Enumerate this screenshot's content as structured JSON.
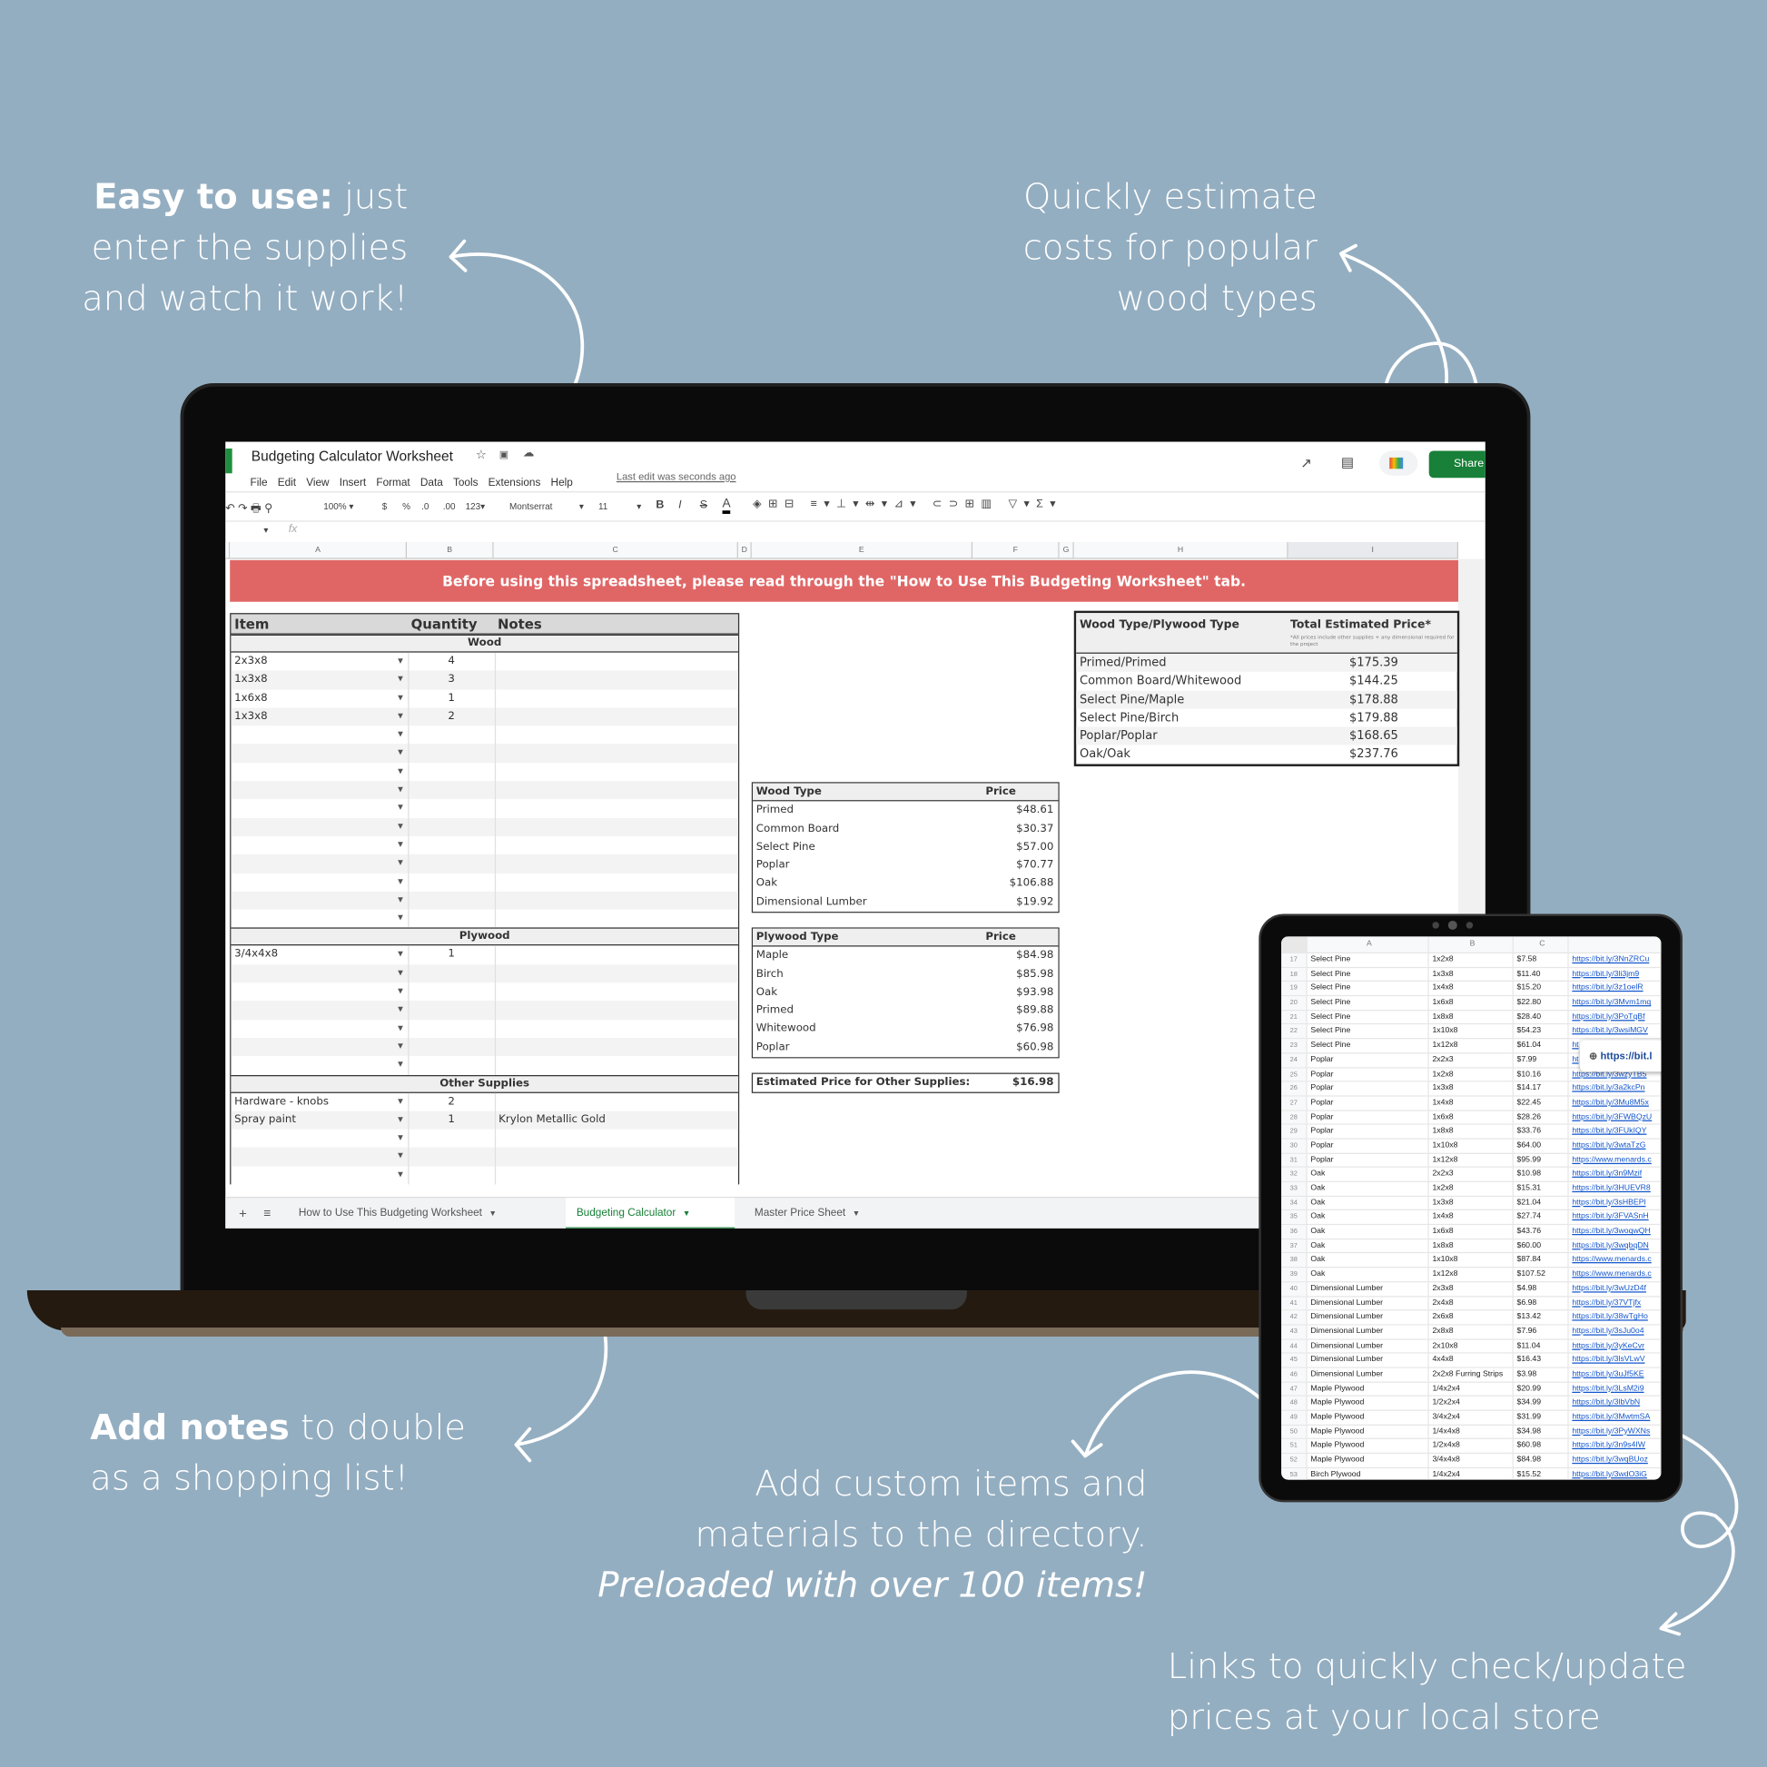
{
  "colors": {
    "background": "#94aec1",
    "banner": "#e06666",
    "share": "#188038",
    "active_tab": "#188038",
    "link": "#1155cc"
  },
  "callouts": {
    "easy": {
      "bold": "Easy to use:",
      "rest": " just",
      "line2": "enter the supplies",
      "line3": "and watch it work!"
    },
    "quick": {
      "line1": "Quickly estimate",
      "line2": "costs for popular",
      "line3": "wood types"
    },
    "notes": {
      "bold": "Add notes",
      "rest": " to double",
      "line2": "as a shopping list!"
    },
    "custom": {
      "line1": "Add custom items and",
      "line2": "materials to the directory.",
      "line3": "Preloaded with over 100 items!"
    },
    "links": {
      "line1": "Links to quickly check/update",
      "line2": "prices at your local store"
    }
  },
  "sheet": {
    "title": "Budgeting Calculator Worksheet",
    "menu": [
      "File",
      "Edit",
      "View",
      "Insert",
      "Format",
      "Data",
      "Tools",
      "Extensions",
      "Help"
    ],
    "last_edit": "Last edit was seconds ago",
    "share_label": "Share",
    "toolbar": {
      "zoom": "100%",
      "currency": "$",
      "percent": "%",
      "dec_less": ".0",
      "dec_more": ".00",
      "format": "123",
      "font": "Montserrat",
      "size": "11",
      "bold": "B",
      "italic": "I",
      "strike": "S",
      "text_color": "A"
    },
    "fx": "fx",
    "columns": [
      "A",
      "B",
      "C",
      "D",
      "E",
      "F",
      "G",
      "H",
      "I"
    ],
    "banner": "Before using this spreadsheet, please read through the \"How to Use This Budgeting Worksheet\" tab.",
    "items_table": {
      "headers": {
        "item": "Item",
        "quantity": "Quantity",
        "notes": "Notes"
      },
      "sections": [
        {
          "title": "Wood",
          "rows": [
            {
              "item": "2x3x8",
              "qty": "4",
              "notes": ""
            },
            {
              "item": "1x3x8",
              "qty": "3",
              "notes": ""
            },
            {
              "item": "1x6x8",
              "qty": "1",
              "notes": ""
            },
            {
              "item": "1x3x8",
              "qty": "2",
              "notes": ""
            },
            {},
            {},
            {},
            {},
            {},
            {},
            {},
            {},
            {},
            {},
            {}
          ]
        },
        {
          "title": "Plywood",
          "rows": [
            {
              "item": "3/4x4x8",
              "qty": "1",
              "notes": ""
            },
            {},
            {},
            {},
            {},
            {},
            {}
          ]
        },
        {
          "title": "Other Supplies",
          "rows": [
            {
              "item": "Hardware - knobs",
              "qty": "2",
              "notes": ""
            },
            {
              "item": "Spray paint",
              "qty": "1",
              "notes": "Krylon Metallic Gold"
            },
            {},
            {},
            {}
          ]
        }
      ]
    },
    "wood_prices": {
      "headers": [
        "Wood Type",
        "Price"
      ],
      "rows": [
        [
          "Primed",
          "$48.61"
        ],
        [
          "Common Board",
          "$30.37"
        ],
        [
          "Select Pine",
          "$57.00"
        ],
        [
          "Poplar",
          "$70.77"
        ],
        [
          "Oak",
          "$106.88"
        ],
        [
          "Dimensional Lumber",
          "$19.92"
        ]
      ]
    },
    "plywood_prices": {
      "headers": [
        "Plywood Type",
        "Price"
      ],
      "rows": [
        [
          "Maple",
          "$84.98"
        ],
        [
          "Birch",
          "$85.98"
        ],
        [
          "Oak",
          "$93.98"
        ],
        [
          "Primed",
          "$89.88"
        ],
        [
          "Whitewood",
          "$76.98"
        ],
        [
          "Poplar",
          "$60.98"
        ]
      ]
    },
    "other_supplies": {
      "label": "Estimated Price for Other Supplies:",
      "value": "$16.98"
    },
    "summary": {
      "headers": [
        "Wood Type/Plywood Type",
        "Total Estimated Price*"
      ],
      "footnote": "*All prices include other supplies + any dimensional required for the project",
      "rows": [
        [
          "Primed/Primed",
          "$175.39"
        ],
        [
          "Common Board/Whitewood",
          "$144.25"
        ],
        [
          "Select Pine/Maple",
          "$178.88"
        ],
        [
          "Select Pine/Birch",
          "$179.88"
        ],
        [
          "Poplar/Poplar",
          "$168.65"
        ],
        [
          "Oak/Oak",
          "$237.76"
        ]
      ]
    },
    "tabs": [
      {
        "label": "How to Use This Budgeting Worksheet",
        "active": false
      },
      {
        "label": "Budgeting Calculator",
        "active": true
      },
      {
        "label": "Master Price Sheet",
        "active": false
      }
    ]
  },
  "tablet": {
    "columns": [
      "A",
      "B",
      "C"
    ],
    "tooltip": "https://bit.l",
    "rows": [
      [
        "17",
        "Select Pine",
        "1x2x8",
        "$7.58",
        "https://bit.ly/3NnZRCu"
      ],
      [
        "18",
        "Select Pine",
        "1x3x8",
        "$11.40",
        "https://bit.ly/3li3jm9"
      ],
      [
        "19",
        "Select Pine",
        "1x4x8",
        "$15.20",
        "https://bit.ly/3z1oelR"
      ],
      [
        "20",
        "Select Pine",
        "1x6x8",
        "$22.80",
        "https://bit.ly/3Mvm1mq"
      ],
      [
        "21",
        "Select Pine",
        "1x8x8",
        "$28.40",
        "https://bit.ly/3PoTqBf"
      ],
      [
        "22",
        "Select Pine",
        "1x10x8",
        "$54.23",
        "https://bit.ly/3wsiMGV"
      ],
      [
        "23",
        "Select Pine",
        "1x12x8",
        "$61.04",
        "ht"
      ],
      [
        "24",
        "Poplar",
        "2x2x3",
        "$7.99",
        "ht"
      ],
      [
        "25",
        "Poplar",
        "1x2x8",
        "$10.16",
        "https://bit.ly/3wzyTB5"
      ],
      [
        "26",
        "Poplar",
        "1x3x8",
        "$14.17",
        "https://bit.ly/3a2kcPn"
      ],
      [
        "27",
        "Poplar",
        "1x4x8",
        "$22.45",
        "https://bit.ly/3Mu8M5x"
      ],
      [
        "28",
        "Poplar",
        "1x6x8",
        "$28.26",
        "https://bit.ly/3FWBQzU"
      ],
      [
        "29",
        "Poplar",
        "1x8x8",
        "$33.76",
        "https://bit.ly/3FUkIQY"
      ],
      [
        "30",
        "Poplar",
        "1x10x8",
        "$64.00",
        "https://bit.ly/3wtaTzG"
      ],
      [
        "31",
        "Poplar",
        "1x12x8",
        "$95.99",
        "https://www.menards.c"
      ],
      [
        "32",
        "Oak",
        "2x2x3",
        "$10.98",
        "https://bit.ly/3n9Mzif"
      ],
      [
        "33",
        "Oak",
        "1x2x8",
        "$15.31",
        "https://bit.ly/3HUEVR8"
      ],
      [
        "34",
        "Oak",
        "1x3x8",
        "$21.04",
        "https://bit.ly/3sHBEPl"
      ],
      [
        "35",
        "Oak",
        "1x4x8",
        "$27.74",
        "https://bit.ly/3FVASnH"
      ],
      [
        "36",
        "Oak",
        "1x6x8",
        "$43.76",
        "https://bit.ly/3woqwQH"
      ],
      [
        "37",
        "Oak",
        "1x8x8",
        "$60.00",
        "https://bit.ly/3wqbqDN"
      ],
      [
        "38",
        "Oak",
        "1x10x8",
        "$87.84",
        "https://www.menards.c"
      ],
      [
        "39",
        "Oak",
        "1x12x8",
        "$107.52",
        "https://www.menards.c"
      ],
      [
        "40",
        "Dimensional Lumber",
        "2x3x8",
        "$4.98",
        "https://bit.ly/3wUzD4f"
      ],
      [
        "41",
        "Dimensional Lumber",
        "2x4x8",
        "$6.98",
        "https://bit.ly/37VTjfx"
      ],
      [
        "42",
        "Dimensional Lumber",
        "2x6x8",
        "$13.42",
        "https://bit.ly/38wTgHo"
      ],
      [
        "43",
        "Dimensional Lumber",
        "2x8x8",
        "$7.96",
        "https://bit.ly/3sJu0o4"
      ],
      [
        "44",
        "Dimensional Lumber",
        "2x10x8",
        "$11.04",
        "https://bit.ly/3yKeCvr"
      ],
      [
        "45",
        "Dimensional Lumber",
        "4x4x8",
        "$16.43",
        "https://bit.ly/3lsVLwV"
      ],
      [
        "46",
        "Dimensional Lumber",
        "2x2x8 Furring Strips",
        "$3.98",
        "https://bit.ly/3uJf5KE"
      ],
      [
        "47",
        "Maple Plywood",
        "1/4x2x4",
        "$20.99",
        "https://bit.ly/3LsM2i9"
      ],
      [
        "48",
        "Maple Plywood",
        "1/2x2x4",
        "$34.99",
        "https://bit.ly/3lbVbN"
      ],
      [
        "49",
        "Maple Plywood",
        "3/4x2x4",
        "$31.99",
        "https://bit.ly/3MwtmSA"
      ],
      [
        "50",
        "Maple Plywood",
        "1/4x4x8",
        "$34.98",
        "https://bit.ly/3PyWXNs"
      ],
      [
        "51",
        "Maple Plywood",
        "1/2x4x8",
        "$60.98",
        "https://bit.ly/3n9s4IW"
      ],
      [
        "52",
        "Maple Plywood",
        "3/4x4x8",
        "$84.98",
        "https://bit.ly/3wqBUoz"
      ],
      [
        "53",
        "Birch Plywood",
        "1/4x2x4",
        "$15.52",
        "https://bit.ly/3wdO3iG"
      ]
    ]
  }
}
